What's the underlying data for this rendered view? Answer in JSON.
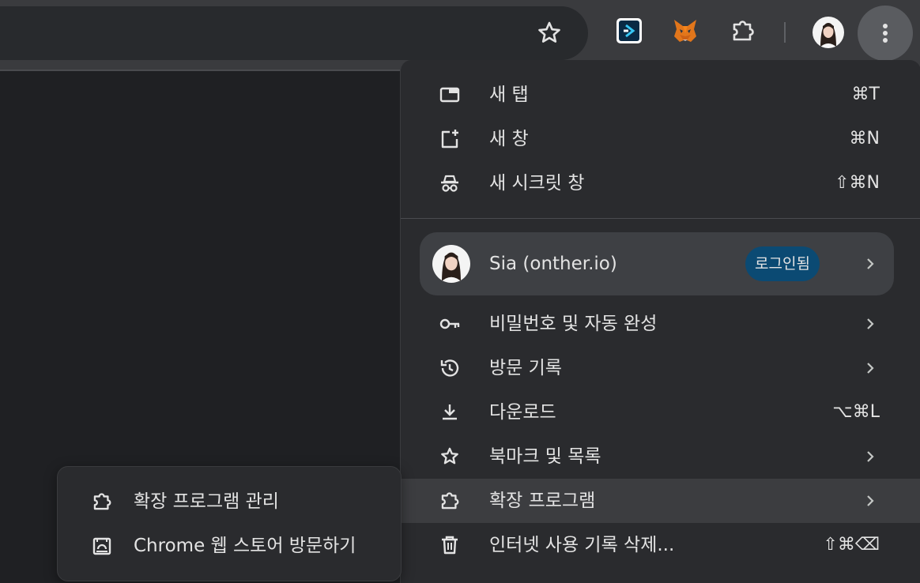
{
  "toolbar": {
    "bookmark_star_icon": "star-outline-icon",
    "extensions": [
      {
        "name": "dappradar-extension",
        "icon": "dappradar-icon"
      },
      {
        "name": "metamask-extension",
        "icon": "metamask-fox-icon"
      },
      {
        "name": "extensions-puzzle",
        "icon": "puzzle-icon"
      }
    ],
    "menu_button_icon": "three-dots-vertical-icon"
  },
  "menu": {
    "items_top": [
      {
        "label": "새 탭",
        "shortcut": "⌘T",
        "icon": "new-tab-icon"
      },
      {
        "label": "새 창",
        "shortcut": "⌘N",
        "icon": "new-window-icon"
      },
      {
        "label": "새 시크릿 창",
        "shortcut": "⇧⌘N",
        "icon": "incognito-icon"
      }
    ],
    "profile": {
      "name": "Sia (onther.io)",
      "status": "로그인됨"
    },
    "items_bottom": [
      {
        "label": "비밀번호 및 자동 완성",
        "shortcut": "",
        "icon": "key-icon",
        "submenu": true
      },
      {
        "label": "방문 기록",
        "shortcut": "",
        "icon": "history-icon",
        "submenu": true
      },
      {
        "label": "다운로드",
        "shortcut": "⌥⌘L",
        "icon": "download-icon",
        "submenu": false
      },
      {
        "label": "북마크 및 목록",
        "shortcut": "",
        "icon": "star-icon",
        "submenu": true
      },
      {
        "label": "확장 프로그램",
        "shortcut": "",
        "icon": "puzzle-icon",
        "submenu": true,
        "highlighted": true
      },
      {
        "label": "인터넷 사용 기록 삭제...",
        "shortcut": "⇧⌘⌫",
        "icon": "trash-icon",
        "submenu": false
      }
    ]
  },
  "submenu": {
    "items": [
      {
        "label": "확장 프로그램 관리",
        "icon": "puzzle-icon"
      },
      {
        "label": "Chrome 웹 스토어 방문하기",
        "icon": "web-store-icon"
      }
    ]
  },
  "colors": {
    "menu_bg": "#2a2b2e",
    "highlight_bg": "#3c3d40",
    "profile_card_bg": "#3e4044",
    "badge_bg": "#0b4a73",
    "text": "#e3e3e3"
  }
}
